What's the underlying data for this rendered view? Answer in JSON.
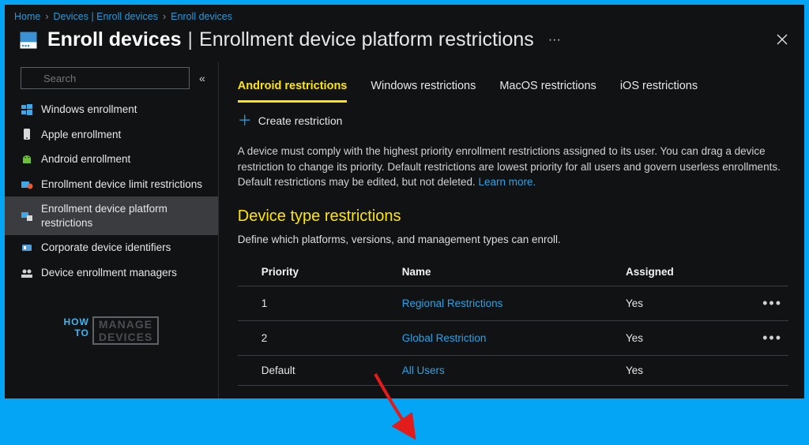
{
  "breadcrumb": {
    "items": [
      "Home",
      "Devices | Enroll devices",
      "Enroll devices"
    ]
  },
  "title": {
    "main": "Enroll devices",
    "sub": "Enrollment device platform restrictions"
  },
  "search": {
    "placeholder": "Search"
  },
  "sidebar": {
    "items": [
      {
        "label": "Windows enrollment",
        "icon": "windows-icon"
      },
      {
        "label": "Apple enrollment",
        "icon": "apple-icon"
      },
      {
        "label": "Android enrollment",
        "icon": "android-icon"
      },
      {
        "label": "Enrollment device limit restrictions",
        "icon": "limit-icon"
      },
      {
        "label": "Enrollment device platform restrictions",
        "icon": "platform-icon"
      },
      {
        "label": "Corporate device identifiers",
        "icon": "identifiers-icon"
      },
      {
        "label": "Device enrollment managers",
        "icon": "managers-icon"
      }
    ],
    "selected_index": 4,
    "watermark": {
      "line1": "HOW",
      "line2": "TO",
      "line3": "MANAGE",
      "line4": "DEVICES"
    }
  },
  "tabs": {
    "items": [
      {
        "label": "Android restrictions"
      },
      {
        "label": "Windows restrictions"
      },
      {
        "label": "MacOS restrictions"
      },
      {
        "label": "iOS restrictions"
      }
    ],
    "active_index": 0
  },
  "create_label": "Create restriction",
  "description": "A device must comply with the highest priority enrollment restrictions assigned to its user. You can drag a device restriction to change its priority. Default restrictions are lowest priority for all users and govern userless enrollments. Default restrictions may be edited, but not deleted.",
  "learn_more": "Learn more.",
  "section": {
    "heading": "Device type restrictions",
    "subheading": "Define which platforms, versions, and management types can enroll."
  },
  "table": {
    "columns": {
      "priority": "Priority",
      "name": "Name",
      "assigned": "Assigned"
    },
    "rows": [
      {
        "priority": "1",
        "name": "Regional Restrictions",
        "assigned": "Yes",
        "has_actions": true
      },
      {
        "priority": "2",
        "name": "Global Restriction",
        "assigned": "Yes",
        "has_actions": true
      },
      {
        "priority": "Default",
        "name": "All Users",
        "assigned": "Yes",
        "has_actions": false
      }
    ]
  },
  "colors": {
    "accent_yellow": "#ffe600",
    "link_blue": "#2aa3e6",
    "bg": "#111214"
  }
}
